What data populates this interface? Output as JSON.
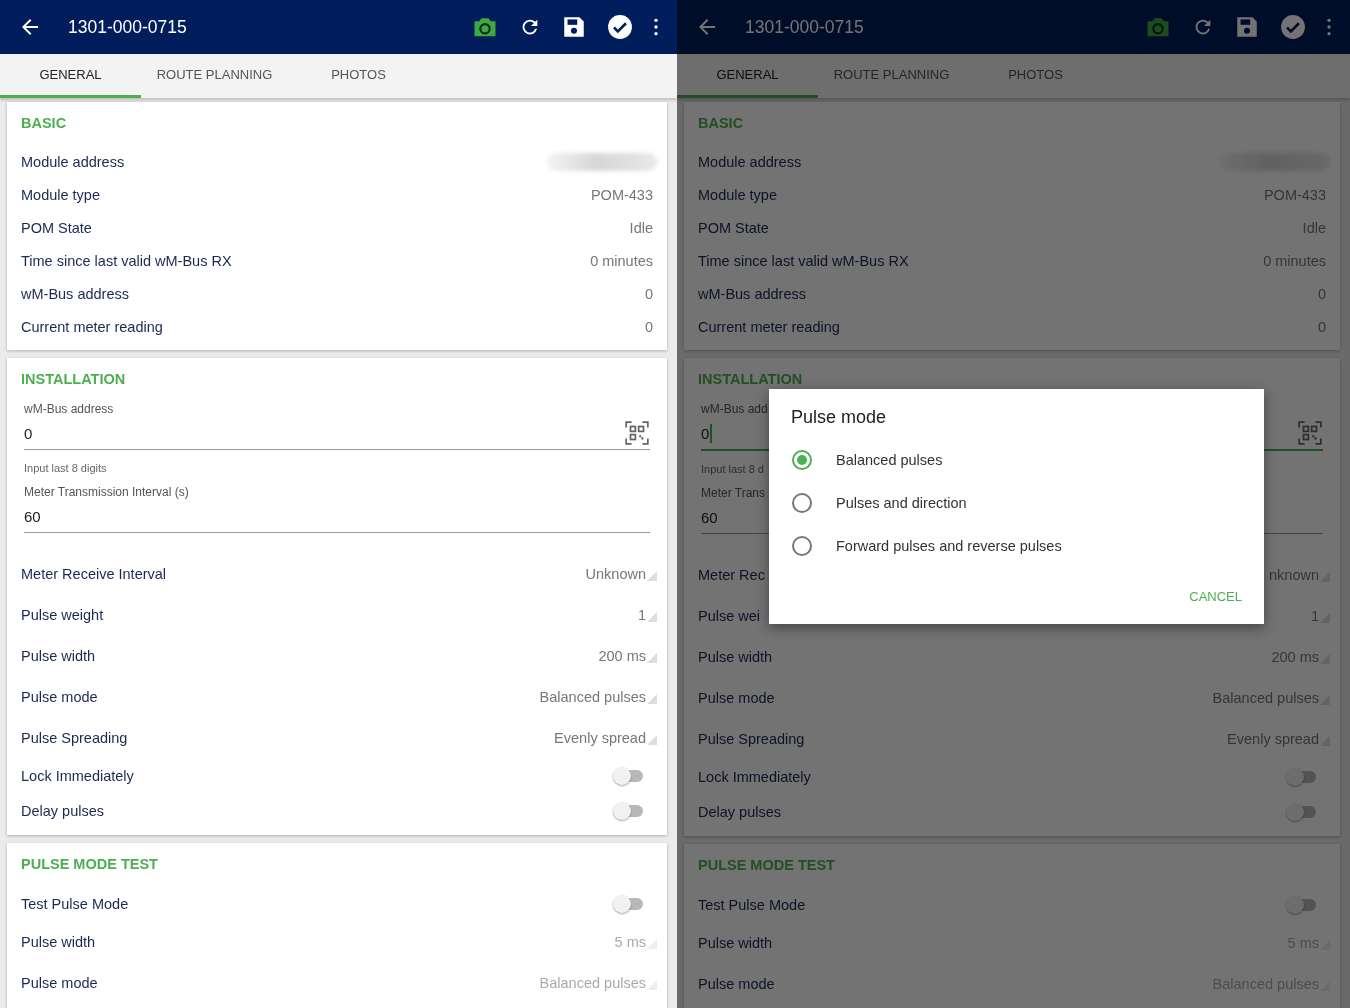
{
  "screens": [
    {
      "toolbar": {
        "title": "1301-000-0715"
      },
      "tabs": [
        {
          "label": "GENERAL",
          "selected": true
        },
        {
          "label": "ROUTE PLANNING",
          "selected": false
        },
        {
          "label": "PHOTOS",
          "selected": false
        }
      ],
      "sections": [
        {
          "title": "BASIC",
          "rows": [
            {
              "kind": "redacted",
              "label": "Module address"
            },
            {
              "kind": "value",
              "label": "Module type",
              "value": "POM-433"
            },
            {
              "kind": "value",
              "label": "POM State",
              "value": "Idle"
            },
            {
              "kind": "value",
              "label": "Time since last valid wM-Bus RX",
              "value": "0 minutes"
            },
            {
              "kind": "value",
              "label": "wM-Bus address",
              "value": "0"
            },
            {
              "kind": "value",
              "label": "Current meter reading",
              "value": "0"
            }
          ]
        },
        {
          "title": "INSTALLATION",
          "rows": [
            {
              "kind": "field",
              "label": "wM-Bus address",
              "value": "0",
              "helper": "Input last 8 digits",
              "scan": true,
              "focused": false
            },
            {
              "kind": "field",
              "label": "Meter Transmission Interval (s)",
              "value": "60",
              "scan": false,
              "focused": false
            },
            {
              "kind": "dropdown",
              "label": "Meter Receive Interval",
              "value": "Unknown",
              "disabled": false
            },
            {
              "kind": "dropdown",
              "label": "Pulse weight",
              "value": "1",
              "disabled": false
            },
            {
              "kind": "dropdown",
              "label": "Pulse width",
              "value": "200 ms",
              "disabled": false
            },
            {
              "kind": "dropdown",
              "label": "Pulse mode",
              "value": "Balanced pulses",
              "disabled": false
            },
            {
              "kind": "dropdown",
              "label": "Pulse Spreading",
              "value": "Evenly spread",
              "disabled": false
            },
            {
              "kind": "toggle",
              "label": "Lock Immediately",
              "on": false
            },
            {
              "kind": "toggle",
              "label": "Delay pulses",
              "on": false
            }
          ]
        },
        {
          "title": "PULSE MODE TEST",
          "rows": [
            {
              "kind": "toggle",
              "label": "Test Pulse Mode",
              "on": false
            },
            {
              "kind": "dropdown",
              "label": "Pulse width",
              "value": "5 ms",
              "disabled": true
            },
            {
              "kind": "dropdown",
              "label": "Pulse mode",
              "value": "Balanced pulses",
              "disabled": true
            }
          ]
        }
      ]
    },
    {
      "toolbar": {
        "title": "1301-000-0715"
      },
      "tabs": [
        {
          "label": "GENERAL",
          "selected": true
        },
        {
          "label": "ROUTE PLANNING",
          "selected": false
        },
        {
          "label": "PHOTOS",
          "selected": false
        }
      ],
      "sections": [
        {
          "title": "BASIC",
          "rows": [
            {
              "kind": "redacted",
              "label": "Module address"
            },
            {
              "kind": "value",
              "label": "Module type",
              "value": "POM-433"
            },
            {
              "kind": "value",
              "label": "POM State",
              "value": "Idle"
            },
            {
              "kind": "value",
              "label": "Time since last valid wM-Bus RX",
              "value": "0 minutes"
            },
            {
              "kind": "value",
              "label": "wM-Bus address",
              "value": "0"
            },
            {
              "kind": "value",
              "label": "Current meter reading",
              "value": "0"
            }
          ]
        },
        {
          "title": "INSTALLATION",
          "rows": [
            {
              "kind": "field",
              "label": "wM-Bus add",
              "value": "0",
              "helper": "Input last 8 d",
              "scan": true,
              "focused": true
            },
            {
              "kind": "field",
              "label": "Meter Trans",
              "value": "60",
              "scan": false,
              "focused": false
            },
            {
              "kind": "dropdown",
              "label": "Meter Rec",
              "value": "nknown",
              "disabled": false
            },
            {
              "kind": "dropdown",
              "label": "Pulse wei",
              "value": "1",
              "disabled": false
            },
            {
              "kind": "dropdown",
              "label": "Pulse width",
              "value": "200 ms",
              "disabled": false
            },
            {
              "kind": "dropdown",
              "label": "Pulse mode",
              "value": "Balanced pulses",
              "disabled": false
            },
            {
              "kind": "dropdown",
              "label": "Pulse Spreading",
              "value": "Evenly spread",
              "disabled": false
            },
            {
              "kind": "toggle",
              "label": "Lock Immediately",
              "on": false
            },
            {
              "kind": "toggle",
              "label": "Delay pulses",
              "on": false
            }
          ]
        },
        {
          "title": "PULSE MODE TEST",
          "rows": [
            {
              "kind": "toggle",
              "label": "Test Pulse Mode",
              "on": false
            },
            {
              "kind": "dropdown",
              "label": "Pulse width",
              "value": "5 ms",
              "disabled": true
            },
            {
              "kind": "dropdown",
              "label": "Pulse mode",
              "value": "Balanced pulses",
              "disabled": true
            }
          ]
        }
      ],
      "dialog": {
        "title": "Pulse mode",
        "options": [
          {
            "label": "Balanced pulses",
            "selected": true
          },
          {
            "label": "Pulses and direction",
            "selected": false
          },
          {
            "label": "Forward pulses and reverse pulses",
            "selected": false
          }
        ],
        "cancel": "CANCEL"
      }
    }
  ]
}
